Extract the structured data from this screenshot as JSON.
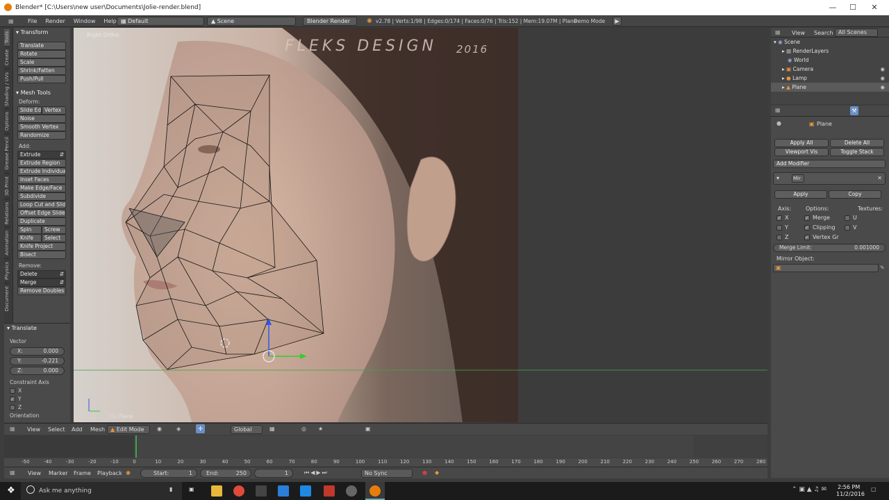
{
  "window": {
    "title": "Blender* [C:\\Users\\new user\\Documents\\Jolie-render.blend]"
  },
  "info_header": {
    "menus": [
      "File",
      "Render",
      "Window",
      "Help"
    ],
    "layout": "Default",
    "scene": "Scene",
    "engine": "Blender Render",
    "stats": "v2.78 | Verts:1/98 | Edges:0/174 | Faces:0/76 | Tris:152 | Mem:19.07M | Plane",
    "demo_mode": "Demo Mode"
  },
  "toolshelf": {
    "tabs": [
      "Tools",
      "Create",
      "Shading / UVs",
      "Options",
      "Grease Pencil",
      "3D Print",
      "Relations",
      "Animation",
      "Physics",
      "Document"
    ],
    "transform_title": "Transform",
    "transform_buttons": [
      "Translate",
      "Rotate",
      "Scale",
      "Shrink/Fatten",
      "Push/Pull"
    ],
    "mesh_tools_title": "Mesh Tools",
    "deform_label": "Deform:",
    "slide_edge": "Slide Ed",
    "vertex": "Vertex",
    "deform_buttons": [
      "Noise",
      "Smooth Vertex",
      "Randomize"
    ],
    "add_label": "Add:",
    "extrude": "Extrude",
    "add_buttons": [
      "Extrude Region",
      "Extrude Individual",
      "Inset Faces",
      "Make Edge/Face",
      "Subdivide",
      "Loop Cut and Slide",
      "Offset Edge Slide",
      "Duplicate"
    ],
    "spin": "Spin",
    "screw": "Screw",
    "knife": "Knife",
    "select": "Select",
    "knife_project": "Knife Project",
    "bisect": "Bisect",
    "remove_label": "Remove:",
    "delete": "Delete",
    "merge": "Merge",
    "remove_doubles": "Remove Doubles"
  },
  "operator_panel": {
    "title": "Translate",
    "vector_label": "Vector",
    "x_label": "X:",
    "x_value": "0.000",
    "y_label": "Y:",
    "y_value": "-0.221",
    "z_label": "Z:",
    "z_value": "0.000",
    "constraint_label": "Constraint Axis",
    "axes": [
      "X",
      "Y",
      "Z"
    ],
    "orientation_label": "Orientation"
  },
  "viewport": {
    "view_name": "Right Ortho",
    "watermark": "FLEKS DESIGN",
    "watermark_year": "2016",
    "object_label": "(1) Plane"
  },
  "view3d_header": {
    "menus": [
      "View",
      "Select",
      "Add",
      "Mesh"
    ],
    "mode": "Edit Mode",
    "orientation": "Global"
  },
  "outliner": {
    "view": "View",
    "search": "Search",
    "filter": "All Scenes",
    "items": [
      "Scene",
      "RenderLayers",
      "World",
      "Camera",
      "Lamp",
      "Plane"
    ]
  },
  "properties": {
    "object_name": "Plane",
    "apply_all": "Apply All",
    "delete_all": "Delete All",
    "viewport_vis": "Viewport Vis",
    "toggle_stack": "Toggle Stack",
    "add_modifier": "Add Modifier",
    "modifier_name": "Mir",
    "apply": "Apply",
    "copy": "Copy",
    "axis_label": "Axis:",
    "options_label": "Options:",
    "textures_label": "Textures:",
    "axis_x": "X",
    "axis_y": "Y",
    "axis_z": "Z",
    "opt_merge": "Merge",
    "opt_clipping": "Clipping",
    "opt_vertex_gr": "Vertex Gr",
    "tex_u": "U",
    "tex_v": "V",
    "merge_limit_label": "Merge Limit:",
    "merge_limit_value": "0.001000",
    "mirror_object_label": "Mirror Object:"
  },
  "timeline": {
    "ticks": [
      "-50",
      "-40",
      "-30",
      "-20",
      "-10",
      "0",
      "10",
      "20",
      "30",
      "40",
      "50",
      "60",
      "70",
      "80",
      "90",
      "100",
      "110",
      "120",
      "130",
      "140",
      "150",
      "160",
      "170",
      "180",
      "190",
      "200",
      "210",
      "220",
      "230",
      "240",
      "250",
      "260",
      "270",
      "280"
    ],
    "menus": [
      "View",
      "Marker",
      "Frame",
      "Playback"
    ],
    "start_label": "Start:",
    "start_value": "1",
    "end_label": "End:",
    "end_value": "250",
    "current_frame": "1",
    "sync": "No Sync"
  },
  "taskbar": {
    "search_placeholder": "Ask me anything",
    "time": "2:56 PM",
    "date": "11/2/2016"
  }
}
